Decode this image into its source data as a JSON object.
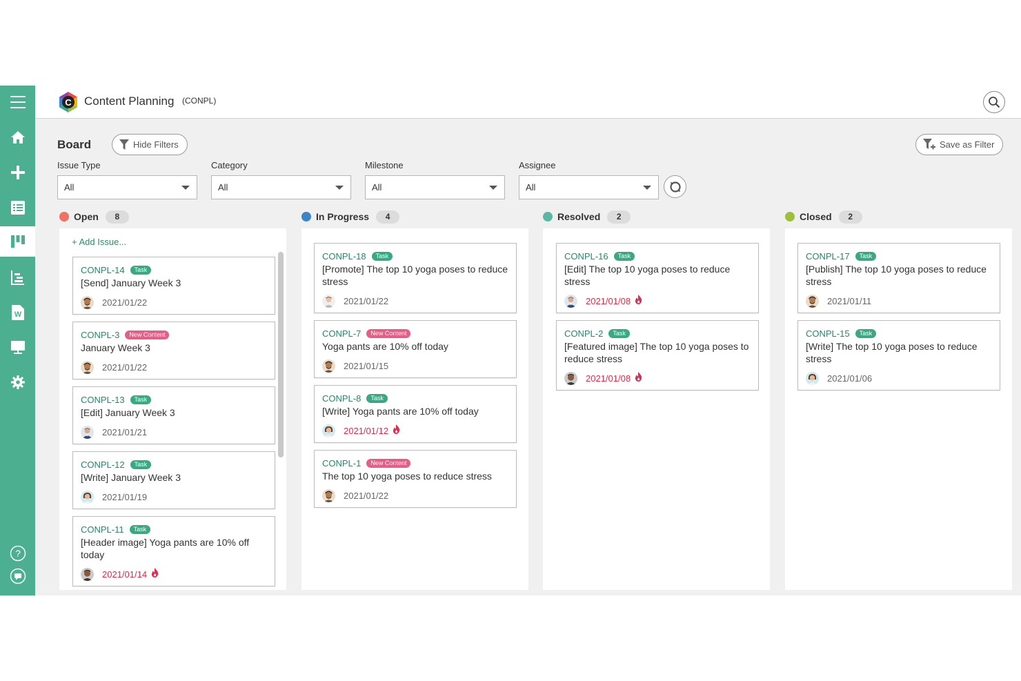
{
  "header": {
    "title": "Content Planning",
    "key": "(CONPL)"
  },
  "board": {
    "title": "Board",
    "hide_filters": "Hide Filters",
    "save_filter": "Save as Filter"
  },
  "filters": [
    {
      "label": "Issue Type",
      "value": "All"
    },
    {
      "label": "Category",
      "value": "All"
    },
    {
      "label": "Milestone",
      "value": "All"
    },
    {
      "label": "Assignee",
      "value": "All"
    }
  ],
  "add_issue": "Add Issue...",
  "colors": {
    "brand": "#4caf8f",
    "open": "#ee7163",
    "in_progress": "#3d85c6",
    "resolved": "#5bb9a3",
    "closed": "#9fbe3a",
    "overdue": "#d9304f"
  },
  "columns": [
    {
      "name": "Open",
      "count": "8",
      "cards": [
        {
          "key": "CONPL-14",
          "badge": "Task",
          "title": "[Send] January Week 3",
          "date": "2021/01/22",
          "overdue": false,
          "avatar": "man-beard"
        },
        {
          "key": "CONPL-3",
          "badge": "New Content",
          "title": "January Week 3",
          "date": "2021/01/22",
          "overdue": false,
          "avatar": "man-beard"
        },
        {
          "key": "CONPL-13",
          "badge": "Task",
          "title": "[Edit] January Week 3",
          "date": "2021/01/21",
          "overdue": false,
          "avatar": "man-suit"
        },
        {
          "key": "CONPL-12",
          "badge": "Task",
          "title": "[Write] January Week 3",
          "date": "2021/01/19",
          "overdue": false,
          "avatar": "woman"
        },
        {
          "key": "CONPL-11",
          "badge": "Task",
          "title": "[Header image] Yoga pants are 10% off today",
          "date": "2021/01/14",
          "overdue": true,
          "avatar": "man-dark"
        }
      ]
    },
    {
      "name": "In Progress",
      "count": "4",
      "cards": [
        {
          "key": "CONPL-18",
          "badge": "Task",
          "title": "[Promote] The top 10 yoga poses to reduce stress",
          "date": "2021/01/22",
          "overdue": false,
          "avatar": "man-light"
        },
        {
          "key": "CONPL-7",
          "badge": "New Content",
          "title": "Yoga pants are 10% off today",
          "date": "2021/01/15",
          "overdue": false,
          "avatar": "man-beard"
        },
        {
          "key": "CONPL-8",
          "badge": "Task",
          "title": "[Write] Yoga pants are 10% off today",
          "date": "2021/01/12",
          "overdue": true,
          "avatar": "woman"
        },
        {
          "key": "CONPL-1",
          "badge": "New Content",
          "title": "The top 10 yoga poses to reduce stress",
          "date": "2021/01/22",
          "overdue": false,
          "avatar": "man-beard"
        }
      ]
    },
    {
      "name": "Resolved",
      "count": "2",
      "cards": [
        {
          "key": "CONPL-16",
          "badge": "Task",
          "title": "[Edit] The top 10 yoga poses to reduce stress",
          "date": "2021/01/08",
          "overdue": true,
          "avatar": "man-suit"
        },
        {
          "key": "CONPL-2",
          "badge": "Task",
          "title": "[Featured image] The top 10 yoga poses to reduce stress",
          "date": "2021/01/08",
          "overdue": true,
          "avatar": "man-dark"
        }
      ]
    },
    {
      "name": "Closed",
      "count": "2",
      "cards": [
        {
          "key": "CONPL-17",
          "badge": "Task",
          "title": "[Publish] The top 10 yoga poses to reduce stress",
          "date": "2021/01/11",
          "overdue": false,
          "avatar": "man-beard"
        },
        {
          "key": "CONPL-15",
          "badge": "Task",
          "title": "[Write] The top 10 yoga poses to reduce stress",
          "date": "2021/01/06",
          "overdue": false,
          "avatar": "woman"
        }
      ]
    }
  ],
  "sidebar": {
    "icons": [
      "menu-icon",
      "home-icon",
      "plus-icon",
      "list-icon",
      "board-icon",
      "gantt-icon",
      "wiki-icon",
      "files-icon",
      "gear-icon",
      "help-icon",
      "chat-icon"
    ]
  }
}
